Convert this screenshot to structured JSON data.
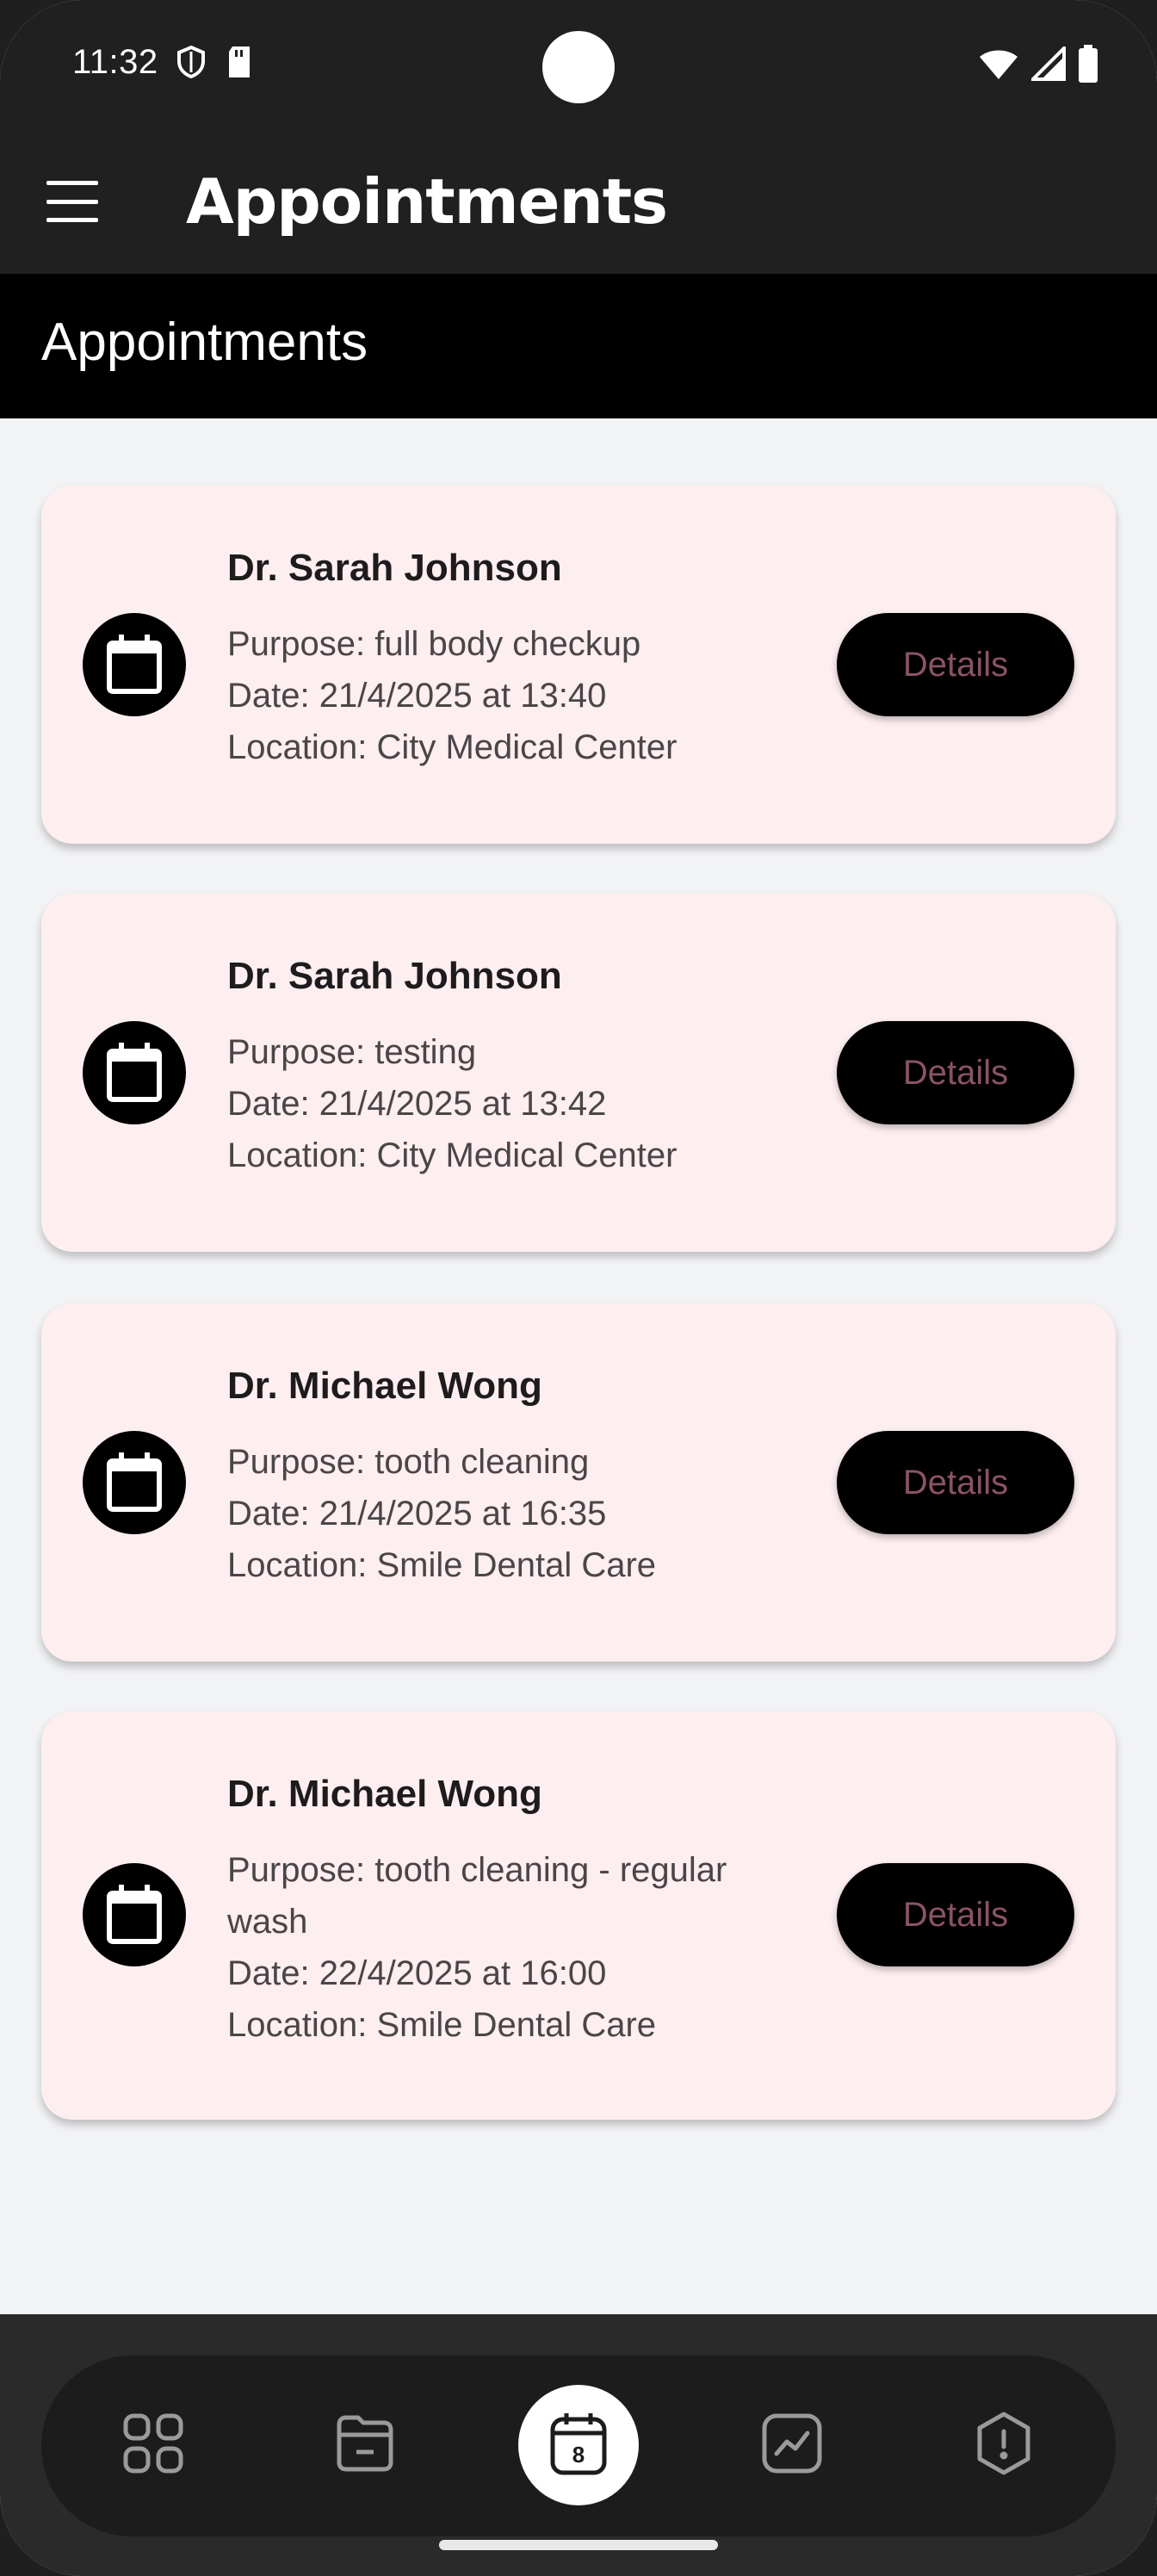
{
  "status_bar": {
    "time": "11:32"
  },
  "app_bar": {
    "title": "Appointments"
  },
  "section": {
    "title": "Appointments"
  },
  "appointments": [
    {
      "doctor": "Dr. Sarah Johnson",
      "purpose": "Purpose: full body checkup",
      "date": "Date: 21/4/2025 at 13:40",
      "location": "Location: City Medical Center",
      "button": "Details"
    },
    {
      "doctor": "Dr. Sarah Johnson",
      "purpose": "Purpose: testing",
      "date": "Date: 21/4/2025 at 13:42",
      "location": "Location: City Medical Center",
      "button": "Details"
    },
    {
      "doctor": "Dr. Michael Wong",
      "purpose": "Purpose: tooth cleaning",
      "date": "Date: 21/4/2025 at 16:35",
      "location": "Location: Smile Dental Care",
      "button": "Details"
    },
    {
      "doctor": "Dr. Michael Wong",
      "purpose": "Purpose: tooth cleaning - regular wash",
      "date": "Date: 22/4/2025 at 16:00",
      "location": "Location: Smile Dental Care",
      "button": "Details"
    }
  ],
  "bottom_nav": {
    "items": [
      {
        "icon": "grid-icon"
      },
      {
        "icon": "folder-icon"
      },
      {
        "icon": "calendar-icon",
        "badge": "8",
        "active": true
      },
      {
        "icon": "chart-icon"
      },
      {
        "icon": "alert-icon"
      }
    ]
  },
  "colors": {
    "card_bg": "#fdeeef",
    "button_bg": "#000000",
    "button_text": "#8a5367",
    "page_bg": "#f2f3f5",
    "topbar_bg": "#202020"
  }
}
